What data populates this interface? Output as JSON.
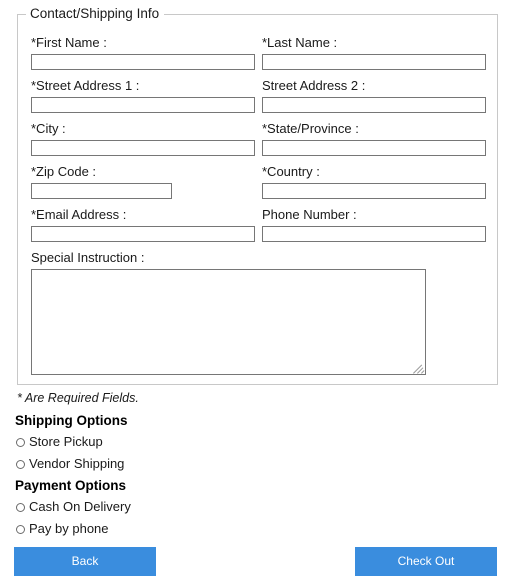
{
  "fieldset": {
    "legend": "Contact/Shipping Info",
    "fields": [
      {
        "label": "*First Name :",
        "value": "",
        "placeholder": ""
      },
      {
        "label": "*Last Name :",
        "value": "",
        "placeholder": ""
      },
      {
        "label": "*Street Address 1 :",
        "value": "",
        "placeholder": ""
      },
      {
        "label": "Street Address 2 :",
        "value": "",
        "placeholder": ""
      },
      {
        "label": "*City :",
        "value": "",
        "placeholder": ""
      },
      {
        "label": "*State/Province :",
        "value": "",
        "placeholder": ""
      },
      {
        "label": "*Zip Code :",
        "value": "",
        "placeholder": ""
      },
      {
        "label": "*Country :",
        "value": "",
        "placeholder": ""
      },
      {
        "label": "*Email Address :",
        "value": "",
        "placeholder": ""
      },
      {
        "label": "Phone Number :",
        "value": "",
        "placeholder": ""
      }
    ],
    "special_instruction": {
      "label": "Special Instruction :",
      "value": "",
      "placeholder": ""
    }
  },
  "required_note": "* Are Required Fields.",
  "shipping": {
    "heading": "Shipping Options",
    "options": [
      {
        "label": "Store Pickup",
        "selected": false
      },
      {
        "label": "Vendor Shipping",
        "selected": false
      }
    ]
  },
  "payment": {
    "heading": "Payment Options",
    "options": [
      {
        "label": "Cash On Delivery",
        "selected": false
      },
      {
        "label": "Pay by phone",
        "selected": false
      }
    ]
  },
  "buttons": {
    "back": "Back",
    "checkout": "Check Out"
  },
  "colors": {
    "button_blue": "#3a8dde",
    "button_text": "#ffffff",
    "fieldset_border": "#c8c8c8",
    "input_border": "#767676"
  }
}
